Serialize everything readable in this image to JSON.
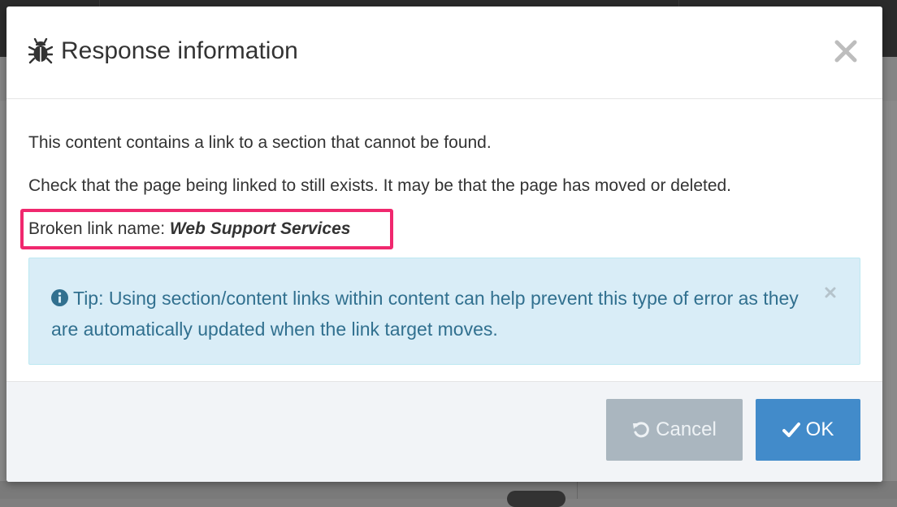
{
  "dialog": {
    "title": "Response information",
    "title_icon": "bug-icon",
    "close_icon": "close-icon"
  },
  "body": {
    "line1": "This content contains a link to a section that cannot be found.",
    "line2": "Check that the page being linked to still exists. It may be that the page has moved or deleted.",
    "broken_link_label": "Broken link name: ",
    "broken_link_name": "Web Support Services",
    "highlight_color": "#f0286e"
  },
  "tip": {
    "icon": "info-circle-icon",
    "text": "Tip: Using section/content links within content can help prevent this type of error as they are automatically updated when the link target moves.",
    "close_icon": "close-icon"
  },
  "footer": {
    "cancel_label": "Cancel",
    "cancel_icon": "undo-icon",
    "ok_label": "OK",
    "ok_icon": "check-icon"
  },
  "colors": {
    "primary": "#428bca",
    "cancel": "#aab6bf",
    "alert_bg": "#d9edf7",
    "alert_text": "#31708f"
  }
}
